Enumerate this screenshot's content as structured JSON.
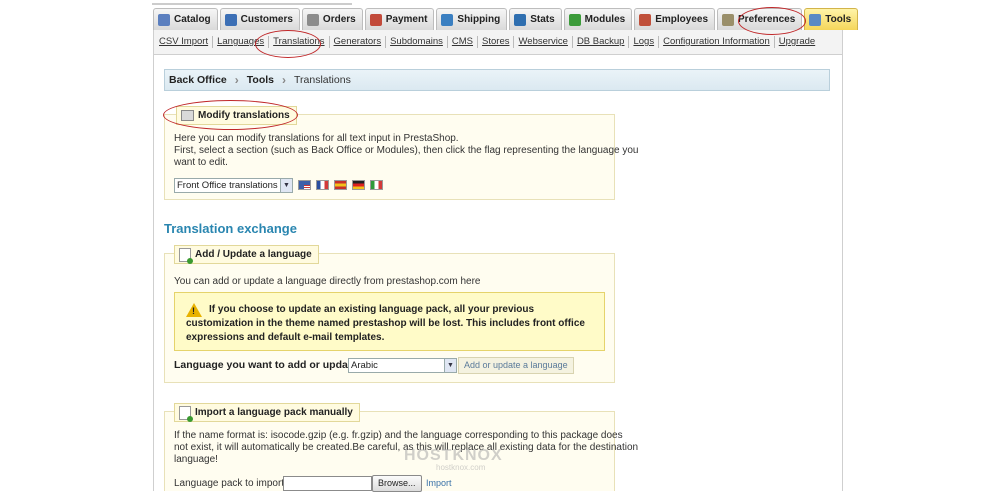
{
  "tabs": [
    {
      "label": "Catalog",
      "icon": "catalog-icon",
      "color": "#5b7fbf"
    },
    {
      "label": "Customers",
      "icon": "customers-icon",
      "color": "#3c6fb5"
    },
    {
      "label": "Orders",
      "icon": "orders-icon",
      "color": "#8c8c8c"
    },
    {
      "label": "Payment",
      "icon": "payment-icon",
      "color": "#c24a3a"
    },
    {
      "label": "Shipping",
      "icon": "shipping-icon",
      "color": "#3a7fc1"
    },
    {
      "label": "Stats",
      "icon": "stats-icon",
      "color": "#2f6fb0"
    },
    {
      "label": "Modules",
      "icon": "modules-icon",
      "color": "#3c9b3a"
    },
    {
      "label": "Employees",
      "icon": "employees-icon",
      "color": "#c0503a"
    },
    {
      "label": "Preferences",
      "icon": "preferences-icon",
      "color": "#9a8f6a"
    },
    {
      "label": "Tools",
      "icon": "tools-icon",
      "color": "#5a8ac4",
      "active": true
    }
  ],
  "subnav": [
    "CSV Import",
    "Languages",
    "Translations",
    "Generators",
    "Subdomains",
    "CMS",
    "Stores",
    "Webservice",
    "DB Backup",
    "Logs",
    "Configuration Information",
    "Upgrade"
  ],
  "breadcrumb": {
    "item1": "Back Office",
    "item2": "Tools",
    "item3": "Translations",
    "separator": "›"
  },
  "modify": {
    "legend": "Modify translations",
    "line1": "Here you can modify translations for all text input in PrestaShop.",
    "line2": "First, select a section (such as Back Office or Modules), then click the flag representing the language you",
    "line3": "want to edit.",
    "select_value": "Front Office translations",
    "flags": [
      "#3c5fa8",
      "#e8e8f8",
      "#d6303a",
      "#333333",
      "#2f9a3a"
    ]
  },
  "exchange": {
    "heading": "Translation exchange",
    "legend": "Add / Update a language",
    "intro": "You can add or update a language directly from prestashop.com here",
    "warning": "If you choose to update an existing language pack, all your previous customization in the theme named prestashop will be lost. This includes front office expressions and default e-mail templates.",
    "label": "Language you want to add or update:",
    "select_value": "Arabic",
    "button": "Add or update a language"
  },
  "import": {
    "legend": "Import a language pack manually",
    "line1": "If the name format is: isocode.gzip (e.g. fr.gzip) and the language corresponding to this package does",
    "line2": "not exist, it will automatically be created.Be careful, as this will replace all existing data for the destination",
    "line3": "language!",
    "label": "Language pack to import:",
    "browse": "Browse...",
    "import_link": "Import"
  },
  "watermark": "HOSTKNOX",
  "watermark_sub": "hostknox.com"
}
